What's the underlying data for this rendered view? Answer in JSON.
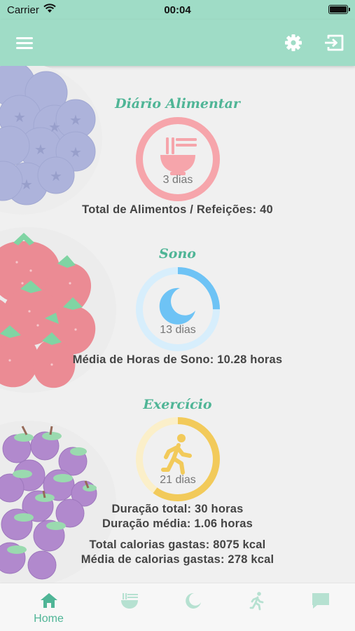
{
  "status_bar": {
    "carrier": "Carrier",
    "time": "00:04"
  },
  "app_bar": {
    "menu_icon": "hamburger-menu-icon",
    "settings_icon": "gear-icon",
    "logout_icon": "exit-icon"
  },
  "colors": {
    "mint": "#9fdcc6",
    "title_green": "#4fb596",
    "food": "#f6a5ab",
    "sleep": "#6ec3f5",
    "exercise": "#f2ca5a"
  },
  "sections": {
    "food": {
      "title": "Diário Alimentar",
      "days": "3 dias",
      "progress": 1.0,
      "stat": "Total de Alimentos / Refeições: 40"
    },
    "sleep": {
      "title": "Sono",
      "days": "13 dias",
      "progress": 0.25,
      "stat": "Média de Horas de Sono: 10.28 horas"
    },
    "exercise": {
      "title": "Exercício",
      "days": "21 dias",
      "progress": 0.6,
      "stats": [
        "Duração total: 30 horas",
        "Duração média: 1.06 horas",
        "Total calorias gastas: 8075 kcal",
        "Média de calorias gastas: 278 kcal"
      ]
    }
  },
  "tabs": [
    {
      "label": "Home",
      "icon": "home-icon",
      "active": true
    },
    {
      "label": "",
      "icon": "bowl-icon",
      "active": false
    },
    {
      "label": "",
      "icon": "moon-icon",
      "active": false
    },
    {
      "label": "",
      "icon": "running-icon",
      "active": false
    },
    {
      "label": "",
      "icon": "chat-icon",
      "active": false
    }
  ]
}
